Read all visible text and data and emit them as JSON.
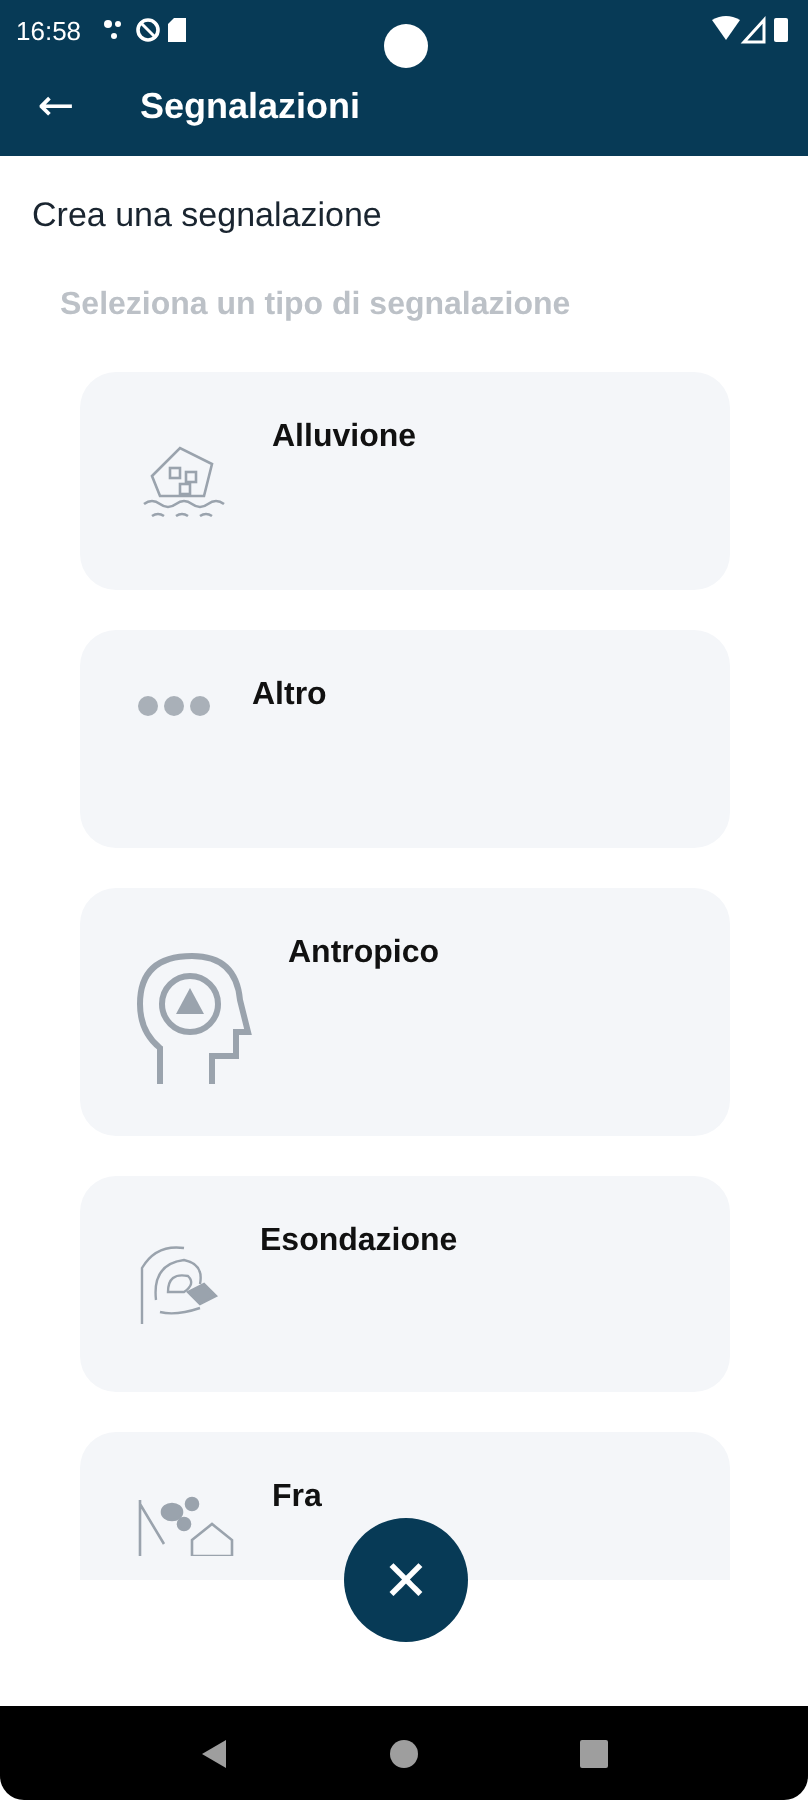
{
  "status_bar": {
    "time": "16:58"
  },
  "app_bar": {
    "back": "←",
    "title": "Segnalazioni"
  },
  "heading": "Crea una segnalazione",
  "subheading": "Seleziona un tipo di segnalazione",
  "types": [
    {
      "kind": "flood",
      "label": "Alluvione"
    },
    {
      "kind": "other",
      "label": "Altro"
    },
    {
      "kind": "human",
      "label": "Antropico"
    },
    {
      "kind": "overflow",
      "label": "Esondazione"
    },
    {
      "kind": "landslide",
      "label": "Fra"
    }
  ],
  "fab": {
    "symbol": "✕"
  }
}
